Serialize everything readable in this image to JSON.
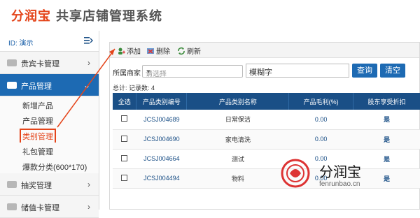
{
  "header": {
    "brand": "分润宝",
    "system": "共享店铺管理系统"
  },
  "sidebar": {
    "id_text": "ID: 演示",
    "items": [
      {
        "label": "贵宾卡管理"
      },
      {
        "label": "产品管理",
        "active": true
      },
      {
        "label": "抽奖管理"
      },
      {
        "label": "储值卡管理"
      }
    ],
    "subitems": [
      {
        "label": "新增产品"
      },
      {
        "label": "产品管理"
      },
      {
        "label": "类别管理",
        "selected": true
      },
      {
        "label": "礼包管理"
      },
      {
        "label": "爆款分类(600*170)"
      }
    ]
  },
  "toolbar": {
    "add": "添加",
    "delete": "删除",
    "refresh": "刷新"
  },
  "filter": {
    "label": "所属商家",
    "select_placeholder": "请选择",
    "text_value": "模糊字",
    "search": "查询",
    "clear": "清空"
  },
  "total": "总计: 记录数: 4",
  "table": {
    "headers": [
      "全选",
      "产品类别编号",
      "产品类别名称",
      "产品毛利(%)",
      "股东享受折扣"
    ],
    "rows": [
      {
        "code": "JCSJ004689",
        "name": "日常保洁",
        "margin": "0.00",
        "discount": "是"
      },
      {
        "code": "JCSJ004690",
        "name": "家电清洗",
        "margin": "0.00",
        "discount": "是"
      },
      {
        "code": "JCSJ004664",
        "name": "测试",
        "margin": "0.00",
        "discount": "是"
      },
      {
        "code": "JCSJ004494",
        "name": "物料",
        "margin": "0.00",
        "discount": "是"
      }
    ]
  },
  "watermark": {
    "cn": "分润宝",
    "en": "fenrunbao.cn"
  },
  "colors": {
    "accent": "#1d6ab3",
    "table_header": "#1a4f86",
    "highlight": "#e4451b"
  }
}
